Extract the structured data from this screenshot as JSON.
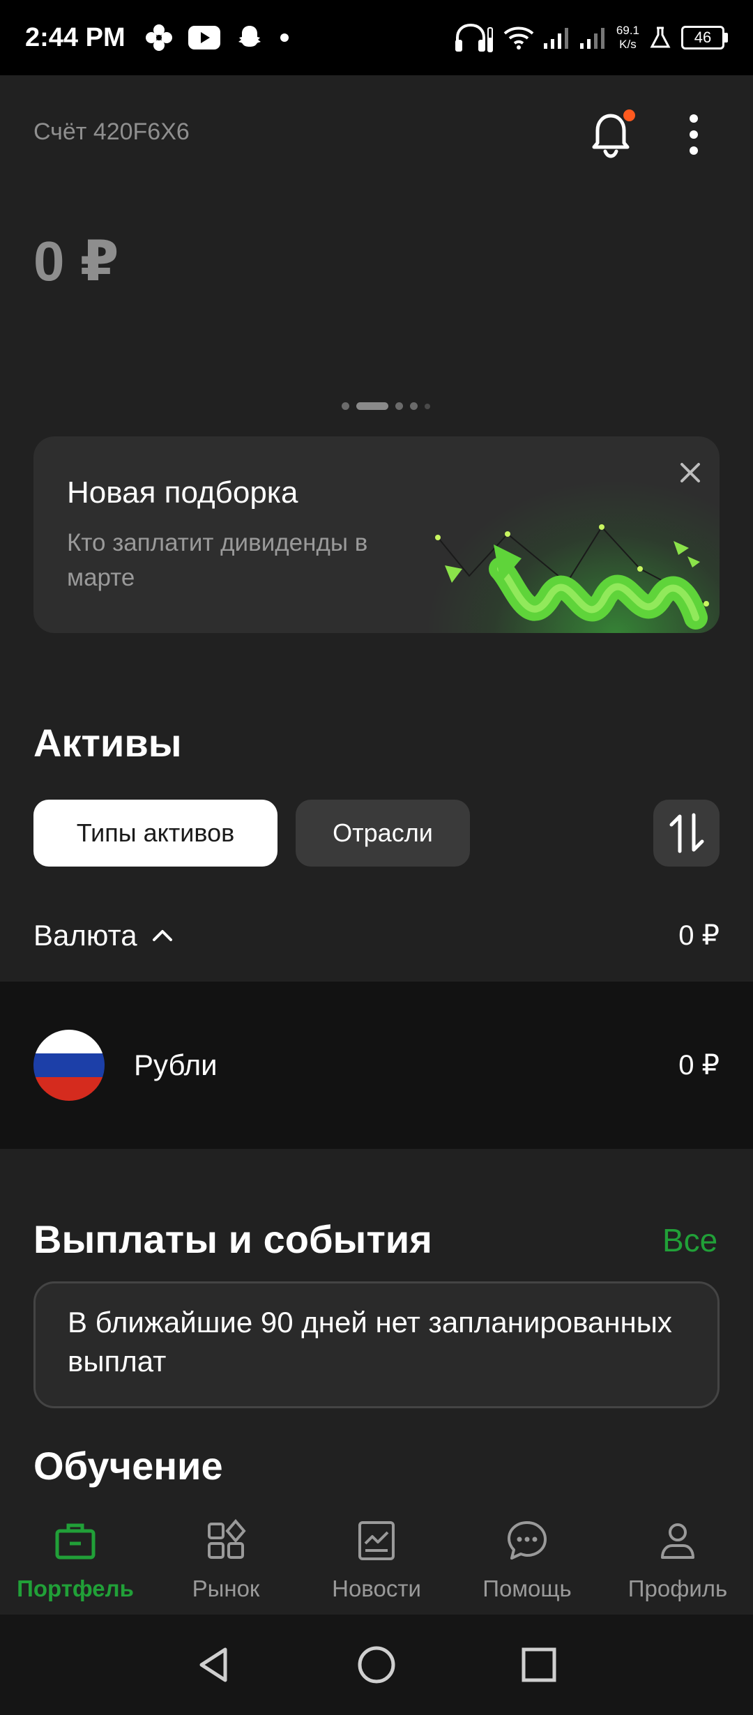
{
  "status_bar": {
    "time": "2:44 PM",
    "net_speed_value": "69.1",
    "net_speed_unit": "K/s",
    "battery": "46",
    "icons": [
      "pinwheel-icon",
      "youtube-icon",
      "snapchat-icon",
      "dot-icon",
      "headphones-icon",
      "wifi-icon",
      "signal-icon",
      "signal-icon",
      "flask-icon",
      "battery-icon"
    ]
  },
  "header": {
    "account_title": "Счёт 420F6X6",
    "notification_icon": "bell-icon",
    "notification_badge_color": "#ff5a1f",
    "menu_icon": "more-vertical-icon"
  },
  "balance": "0 ₽",
  "carousel": {
    "pages": 5,
    "active_index": 1
  },
  "promo": {
    "title": "Новая подборка",
    "subtitle": "Кто заплатит дивиденды в марте",
    "close_icon": "close-icon"
  },
  "assets": {
    "title": "Активы",
    "tabs": [
      {
        "label": "Типы активов",
        "active": true
      },
      {
        "label": "Отрасли",
        "active": false
      }
    ],
    "sort_icon": "sort-arrows-icon",
    "group": {
      "label": "Валюта",
      "value": "0 ₽",
      "expanded": true
    },
    "items": [
      {
        "name": "Рубли",
        "value": "0 ₽",
        "icon": "russia-flag-icon"
      }
    ]
  },
  "events": {
    "title": "Выплаты и события",
    "all_label": "Все",
    "empty_text": "В ближайшие 90 дней нет запланированных выплат"
  },
  "learning": {
    "title": "Обучение"
  },
  "bottom_nav": [
    {
      "label": "Портфель",
      "icon": "briefcase-icon",
      "active": true
    },
    {
      "label": "Рынок",
      "icon": "market-grid-icon",
      "active": false
    },
    {
      "label": "Новости",
      "icon": "news-chart-icon",
      "active": false
    },
    {
      "label": "Помощь",
      "icon": "chat-icon",
      "active": false
    },
    {
      "label": "Профиль",
      "icon": "profile-icon",
      "active": false
    }
  ],
  "colors": {
    "accent": "#21a038",
    "background": "#212121",
    "card": "#2e2e2e"
  }
}
